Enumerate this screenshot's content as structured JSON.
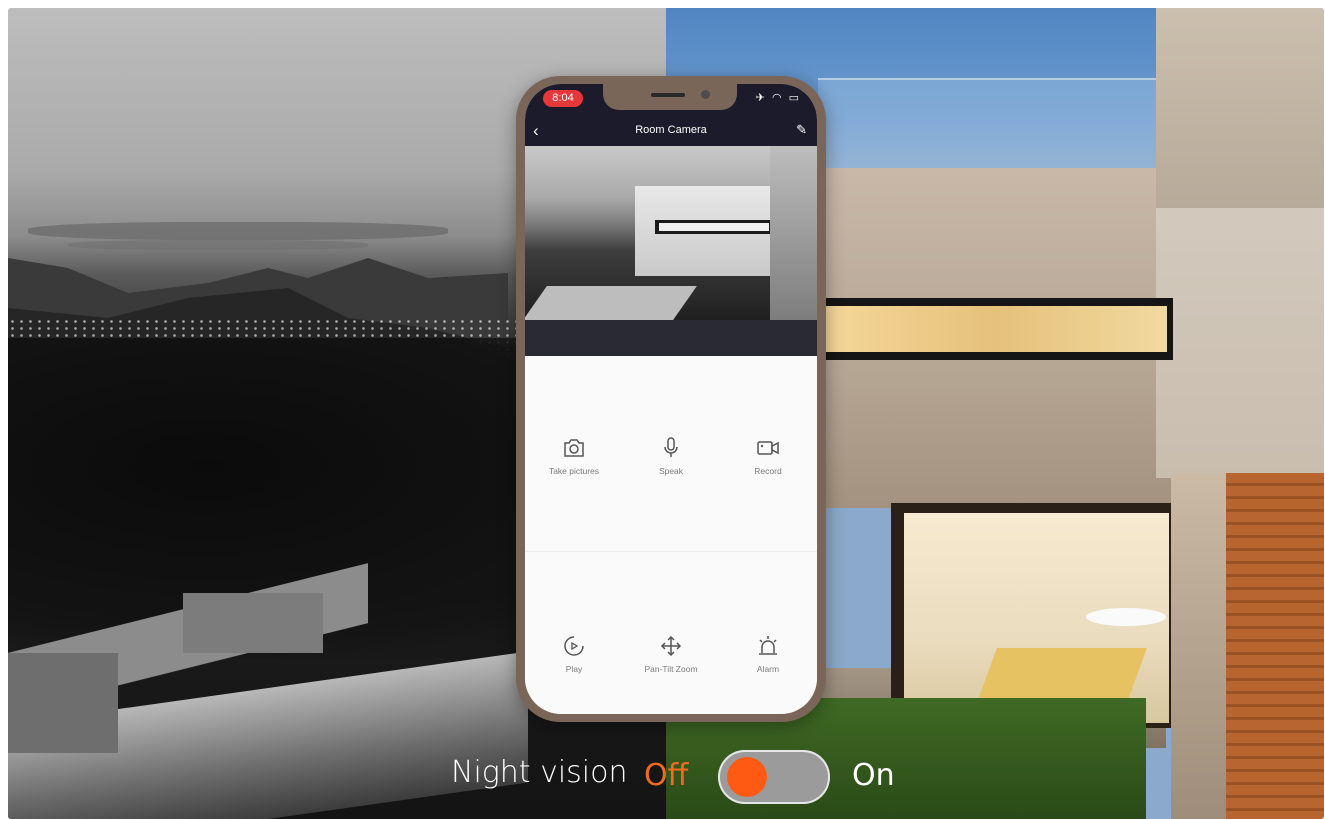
{
  "phone": {
    "time": "8:04",
    "status_icons": "✈ ◠ ▭",
    "nav": {
      "back_icon": "chevron-left-icon",
      "title": "Room Camera",
      "edit_icon": "pencil-icon"
    },
    "controls": [
      {
        "icon": "camera-icon",
        "label": "Take pictures"
      },
      {
        "icon": "microphone-icon",
        "label": "Speak"
      },
      {
        "icon": "video-camera-icon",
        "label": "Record"
      },
      {
        "icon": "play-circle-icon",
        "label": "Play"
      },
      {
        "icon": "pan-tilt-arrows-icon",
        "label": "Pan-Tilt Zoom"
      },
      {
        "icon": "alarm-siren-icon",
        "label": "Alarm"
      }
    ]
  },
  "caption": {
    "label": "Night vision",
    "off": "Off",
    "on": "On",
    "toggle_state": "off"
  },
  "colors": {
    "accent_orange": "#ff5a14",
    "phone_frame": "#7a6658",
    "app_bar": "#1b1b2b",
    "time_pill": "#e5383b"
  }
}
